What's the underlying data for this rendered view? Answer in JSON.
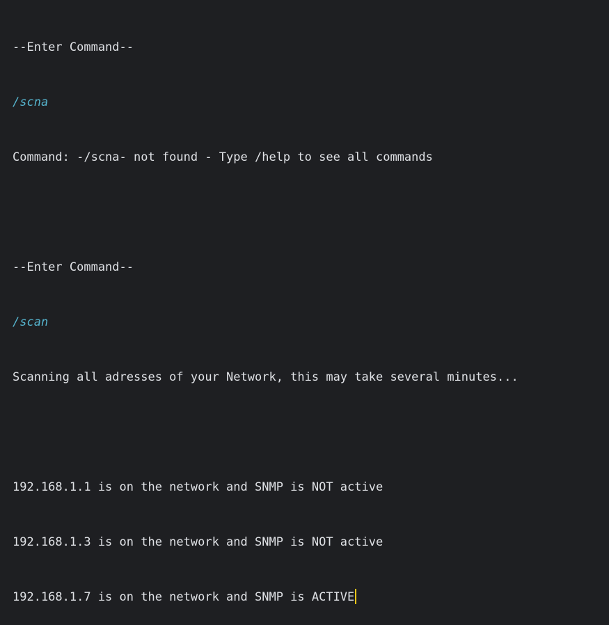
{
  "console": {
    "lines": [
      {
        "kind": "output",
        "text": "--Enter Command--"
      },
      {
        "kind": "input",
        "text": "/scna"
      },
      {
        "kind": "output",
        "text": "Command: -/scna- not found - Type /help to see all commands"
      },
      {
        "kind": "blank",
        "text": ""
      },
      {
        "kind": "output",
        "text": "--Enter Command--"
      },
      {
        "kind": "input",
        "text": "/scan"
      },
      {
        "kind": "output",
        "text": "Scanning all adresses of your Network, this may take several minutes..."
      },
      {
        "kind": "blank",
        "text": ""
      },
      {
        "kind": "output",
        "text": "192.168.1.1 is on the network and SNMP is NOT active"
      },
      {
        "kind": "output",
        "text": "192.168.1.3 is on the network and SNMP is NOT active"
      },
      {
        "kind": "output",
        "text": "192.168.1.7 is on the network and SNMP is ACTIVE"
      }
    ]
  },
  "colors": {
    "background": "#1e1f22",
    "output_text": "#dfe1e5",
    "input_text": "#56b5cf",
    "cursor": "#f5c518"
  }
}
